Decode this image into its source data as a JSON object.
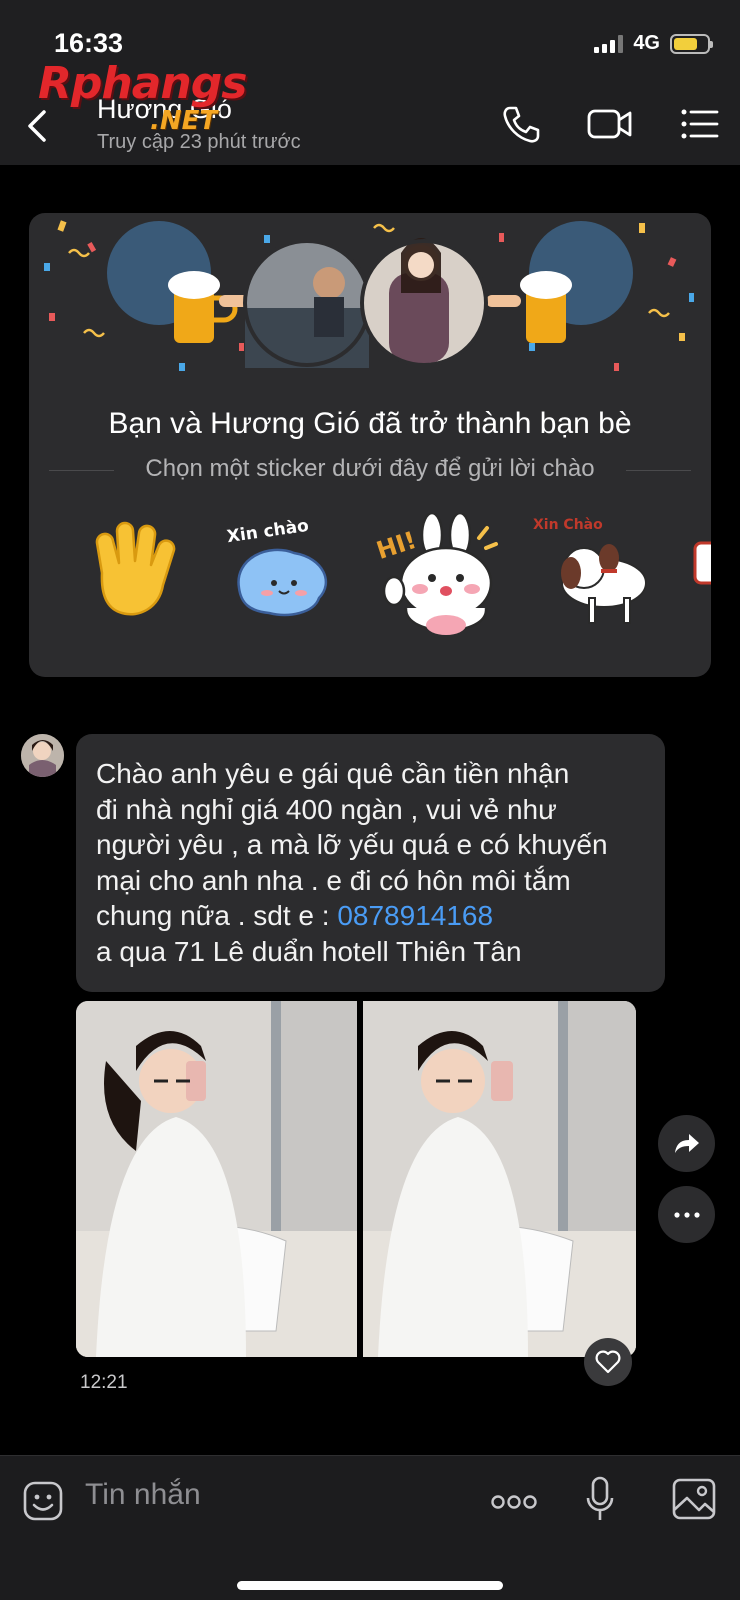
{
  "status_bar": {
    "time": "16:33",
    "network": "4G"
  },
  "header": {
    "contact_name": "Hương Gió",
    "last_seen": "Truy cập 23 phút trước",
    "watermark_main": "Rphangs",
    "watermark_sub": ".NET",
    "icons": [
      "back-icon",
      "phone-icon",
      "video-call-icon",
      "menu-list-icon"
    ]
  },
  "friend_card": {
    "title": "Bạn và Hương Gió đã trở thành bạn bè",
    "subtitle": "Chọn một sticker dưới đây để gửi lời chào",
    "stickers": [
      {
        "name": "waving-hand-sticker"
      },
      {
        "name": "xin-chao-blob-sticker",
        "text": "Xin chào"
      },
      {
        "name": "hi-bunny-sticker",
        "text": "HI!"
      },
      {
        "name": "xin-chao-dog-sticker",
        "text": "Xin Chào"
      }
    ]
  },
  "message": {
    "lines": [
      "Chào anh yêu e gái quê  cần tiền nhận",
      "đi nhà nghỉ giá 400 ngàn , vui vẻ như",
      "người yêu , a mà lỡ yếu quá e có khuyến",
      "mại cho anh nha . e đi có hôn môi tắm"
    ],
    "line5_prefix": "chung nữa . sdt e : ",
    "phone": "0878914168",
    "line6": "a qua 71 Lê duẩn hotell Thiên Tân",
    "time": "12:21"
  },
  "input_bar": {
    "placeholder": "Tin nhắn"
  },
  "colors": {
    "background": "#000000",
    "header_bg": "#1f1f21",
    "bubble_bg": "#2c2c2e",
    "link": "#4a9cf5",
    "battery": "#f2cf3c"
  }
}
